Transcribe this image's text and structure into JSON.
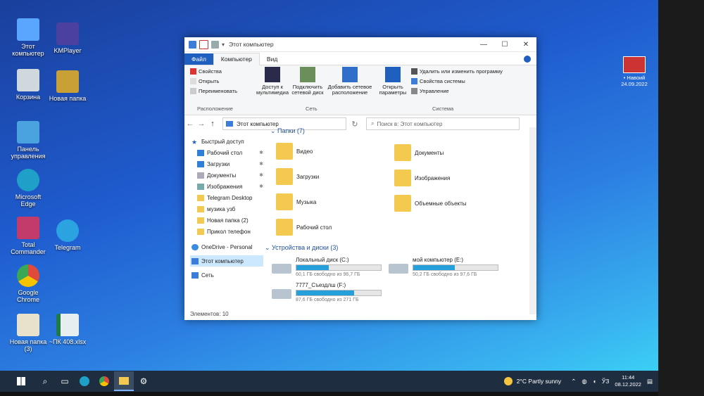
{
  "desktop": {
    "icons": [
      {
        "label": "Этот компьютер",
        "color": "#5aa6ff"
      },
      {
        "label": "KMPlayer",
        "color": "#4b3fa0"
      },
      {
        "label": "Корзина",
        "color": "#cfd8dc"
      },
      {
        "label": "Новая папка",
        "color": "#c8a035"
      },
      {
        "label": "Панель управления",
        "color": "#4aa3df"
      },
      {
        "label": "Microsoft Edge",
        "color": "#1fa0c8"
      },
      {
        "label": "Total Commander",
        "color": "#c23b6b"
      },
      {
        "label": "Telegram",
        "color": "#2aa3e0"
      },
      {
        "label": "Google Chrome",
        "color": "#e04a3a"
      },
      {
        "label": "Новая папка (3)",
        "color": "#e8e2cc"
      },
      {
        "label": "~ПК 408.xlsx",
        "color": "#e6eef0"
      }
    ],
    "widget": {
      "line1": "• Навоий",
      "line2": "24.09.2022"
    }
  },
  "explorer": {
    "title": "Этот компьютер",
    "window_controls": {
      "minimize": "—",
      "maximize": "☐",
      "close": "✕"
    },
    "tabs": {
      "file": "Файл",
      "computer": "Компьютер",
      "view": "Вид"
    },
    "ribbon": {
      "properties": "Свойства",
      "open": "Открыть",
      "rename": "Переименовать",
      "group_location": "Расположение",
      "media_access": "Доступ к мультимедиа",
      "map_drive": "Подключить сетевой диск",
      "add_location": "Добавить сетевое расположение",
      "group_network": "Сеть",
      "open_settings": "Открыть параметры",
      "uninstall": "Удалить или изменить программу",
      "system_props": "Свойства системы",
      "manage": "Управление",
      "group_system": "Система"
    },
    "address": {
      "back": "←",
      "forward": "→",
      "up": "↑",
      "path": "Этот компьютер",
      "refresh": "↻",
      "search_placeholder": "Поиск в: Этот компьютер"
    },
    "nav": {
      "quick_access": "Быстрый доступ",
      "items": [
        "Рабочий стол",
        "Загрузки",
        "Документы",
        "Изображения",
        "Telegram Desktop",
        "музика узб",
        "Новая папка (2)",
        "Прикол телефон"
      ],
      "onedrive": "OneDrive - Personal",
      "this_pc": "Этот компьютер",
      "network": "Сеть"
    },
    "folders_header": "Папки (7)",
    "folders": [
      "Видео",
      "Документы",
      "Загрузки",
      "Изображения",
      "Музыка",
      "Объемные объекты",
      "Рабочий стол"
    ],
    "devices_header": "Устройства и диски (3)",
    "drives": [
      {
        "name": "Локальный диск (C:)",
        "free": "60,1 ГБ свободно из 96,7 ГБ",
        "used": 0.38
      },
      {
        "name": "мой компьютер (E:)",
        "free": "50,2 ГБ свободно из 97,6 ГБ",
        "used": 0.49
      },
      {
        "name": "7777_Съездлш (F:)",
        "free": "87,6 ГБ свободно из 271 ГБ",
        "used": 0.68
      }
    ],
    "status": "Элементов: 10"
  },
  "taskbar": {
    "weather": "2°C  Partly sunny",
    "lang": "ЎЗ",
    "time": "11:44",
    "date": "08.12.2022"
  }
}
